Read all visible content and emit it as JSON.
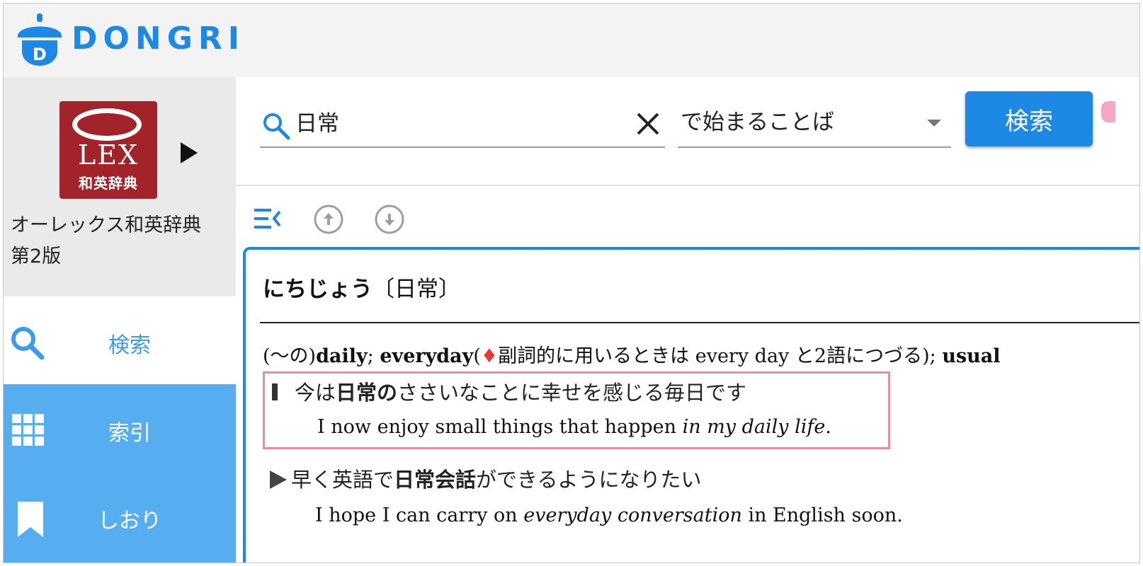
{
  "header": {
    "brand": "DONGRI"
  },
  "sidebar": {
    "dictionary": {
      "logo_main": "LEX",
      "logo_sub": "和英辞典",
      "name_line1": "オーレックス和英辞典",
      "name_line2": "第2版"
    },
    "nav": [
      {
        "label": "検索"
      },
      {
        "label": "索引"
      },
      {
        "label": "しおり"
      }
    ]
  },
  "search": {
    "query": "日常",
    "mode": "で始まることば",
    "button_label": "検索"
  },
  "entry": {
    "headword_kana": "にちじょう",
    "headword_kanji": "〔日常〕",
    "definition": {
      "prefix": "(〜の)",
      "w1": "daily",
      "sep1": "; ",
      "w2": "everyday",
      "note_open": "(",
      "diamond": "♦",
      "note": "副詞的に用いるときは every day と2語につづる",
      "note_close": ");",
      "w3": "usual"
    },
    "examples": [
      {
        "ja_before": "今は",
        "ja_bold": "日常の",
        "ja_after": "ささいなことに幸せを感じる毎日です",
        "en_before": "I now enjoy small things that happen ",
        "en_italic": "in my daily life",
        "en_after": "."
      },
      {
        "ja_before": "早く英語で",
        "ja_bold": "日常会話",
        "ja_after": "ができるようになりたい",
        "en_before": "I hope I can carry on ",
        "en_italic": "everyday conversation",
        "en_after": " in English soon."
      }
    ]
  },
  "colors": {
    "brand_blue": "#1e88e5",
    "nav_active": "#56aef0",
    "highlight_border": "#e98d9e",
    "logo_red": "#a3232b"
  }
}
